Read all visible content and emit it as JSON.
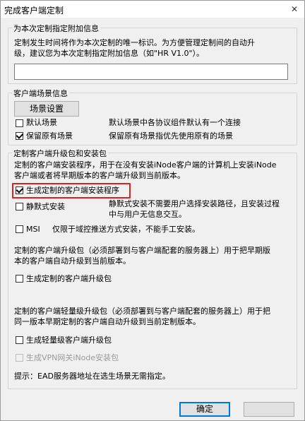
{
  "window": {
    "title": "完成客户端定制",
    "close_glyph": "✕"
  },
  "section_info": {
    "legend": "为本次定制指定附加信息",
    "desc_line1": "定制发生时间将作为本次定制的唯一标识。为方便管理定制间的自动升",
    "desc_line2": "级，建议您为本次定制指定附加信息（如\"HR V1.0\"）。",
    "input_value": ""
  },
  "section_scene": {
    "legend": "客户端场景信息",
    "settings_button": "场景设置",
    "default_scene": {
      "label": "默认场景",
      "checked": false,
      "desc": "默认场景中各协议组件默认有一个连接"
    },
    "keep_scene": {
      "label": "保留原有场景",
      "checked": true,
      "desc": "保留原有场景指优先使用原有的场景"
    }
  },
  "section_package": {
    "legend": "定制客户端升级包和安装包",
    "installer_desc_line1": "定制的客户端安装程序，用于在没有安装iNode客户端的计算机上安装iNode",
    "installer_desc_line2": "客户端或者将早期版本的客户端升级到当前版本。",
    "generate_installer": {
      "label": "生成定制的客户端安装程序",
      "checked": true
    },
    "silent_install": {
      "label": "静默式安装",
      "checked": false,
      "desc_line1": "静默式安装不需要用户选择安装路径，且安装过程",
      "desc_line2": "中与用户无信息交互。"
    },
    "msi": {
      "label": "MSI",
      "checked": false,
      "desc": "仅限于域控推送方式安装，不能手工安装。"
    },
    "upgrade_desc_line1": "定制的客户端升级包（必须部署到与客户端配套的服务器上）用于把早期版",
    "upgrade_desc_line2": "本的客户端自动升级到当前版本。",
    "generate_upgrade": {
      "label": "生成定制的客户端升级包",
      "checked": false
    },
    "light_desc_line1": "定制的客户端轻量级升级包（必须部署到与客户端配套的服务器上）用于把",
    "light_desc_line2": "同一版本早期定制的客户端自动升级到当前定制版本。",
    "generate_light": {
      "label": "生成轻量级客户端升级包",
      "checked": false
    },
    "generate_vpn": {
      "label": "生成VPN网关iNode安装包",
      "checked": false,
      "disabled": true
    },
    "hint": "提示：EAD服务器地址在选生场景无需指定。"
  },
  "footer": {
    "ok_label": "确定",
    "cancel_label": ""
  }
}
